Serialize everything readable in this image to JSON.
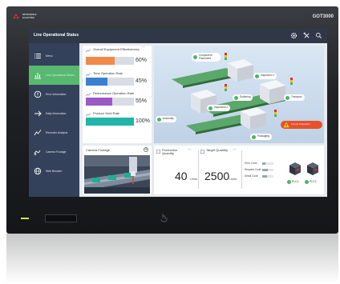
{
  "device": {
    "brand_name": "MITSUBISHI ELECTRIC",
    "model": "GOT3000"
  },
  "app": {
    "title": "Line Operational Status",
    "header_icons": [
      "gear-icon",
      "tools-icon",
      "search-icon"
    ]
  },
  "sidebar": {
    "items": [
      {
        "label": "Menu",
        "icon": "menu-icon",
        "active": false
      },
      {
        "label": "Line Operational Status",
        "icon": "bar-chart-icon",
        "active": true
      },
      {
        "label": "Error Information",
        "icon": "alert-circle-icon",
        "active": false
      },
      {
        "label": "Daily Information",
        "icon": "arrow-right-icon",
        "active": false
      },
      {
        "label": "Recorder Analysis",
        "icon": "line-chart-icon",
        "active": false
      },
      {
        "label": "Camera Footage",
        "icon": "camera-icon",
        "active": false
      },
      {
        "label": "Web Browser",
        "icon": "globe-icon",
        "active": false
      }
    ]
  },
  "kpis": [
    {
      "label": "Overall Equipment Effectiveness",
      "value": "60%",
      "fraction": 0.6,
      "color": "#f08a4b"
    },
    {
      "label": "Time Operation Rate",
      "value": "45%",
      "fraction": 0.45,
      "color": "#3b7fd0"
    },
    {
      "label": "Performance Operation Rate",
      "value": "55%",
      "fraction": 0.55,
      "color": "#9b59c6"
    },
    {
      "label": "Product Yield Rate",
      "value": "100%",
      "fraction": 1.0,
      "color": "#1fb5a8"
    }
  ],
  "flow": {
    "stations": [
      {
        "label": "Component Placement"
      },
      {
        "label": "Inspection 1"
      },
      {
        "label": "Soldering"
      },
      {
        "label": "Transport"
      },
      {
        "label": "Inspection 2"
      },
      {
        "label": "Assembly"
      },
      {
        "label": "Packaging"
      }
    ],
    "alarm": {
      "label": "In-Line Inspection"
    }
  },
  "camera": {
    "title": "Camera Footage"
  },
  "production": {
    "production_quantity": {
      "title": "Production Quantity",
      "value": "40",
      "unit": "Units"
    },
    "target_quantity": {
      "title": "Target Quantity",
      "value": "2500",
      "unit": "Units"
    },
    "error_rows": [
      {
        "label": "Error Code",
        "fraction": 0.3
      },
      {
        "label": "Request Code",
        "fraction": 0.5
      },
      {
        "label": "Detail Code",
        "fraction": 0.4
      }
    ],
    "plcs": [
      {
        "label": "PLC1"
      },
      {
        "label": "PLC2"
      }
    ]
  },
  "colors": {
    "header": "#303848",
    "sidebar": "#33415a",
    "active_item": "#58b870",
    "ok_status": "#4cb464",
    "alarm": "#e8502a"
  }
}
